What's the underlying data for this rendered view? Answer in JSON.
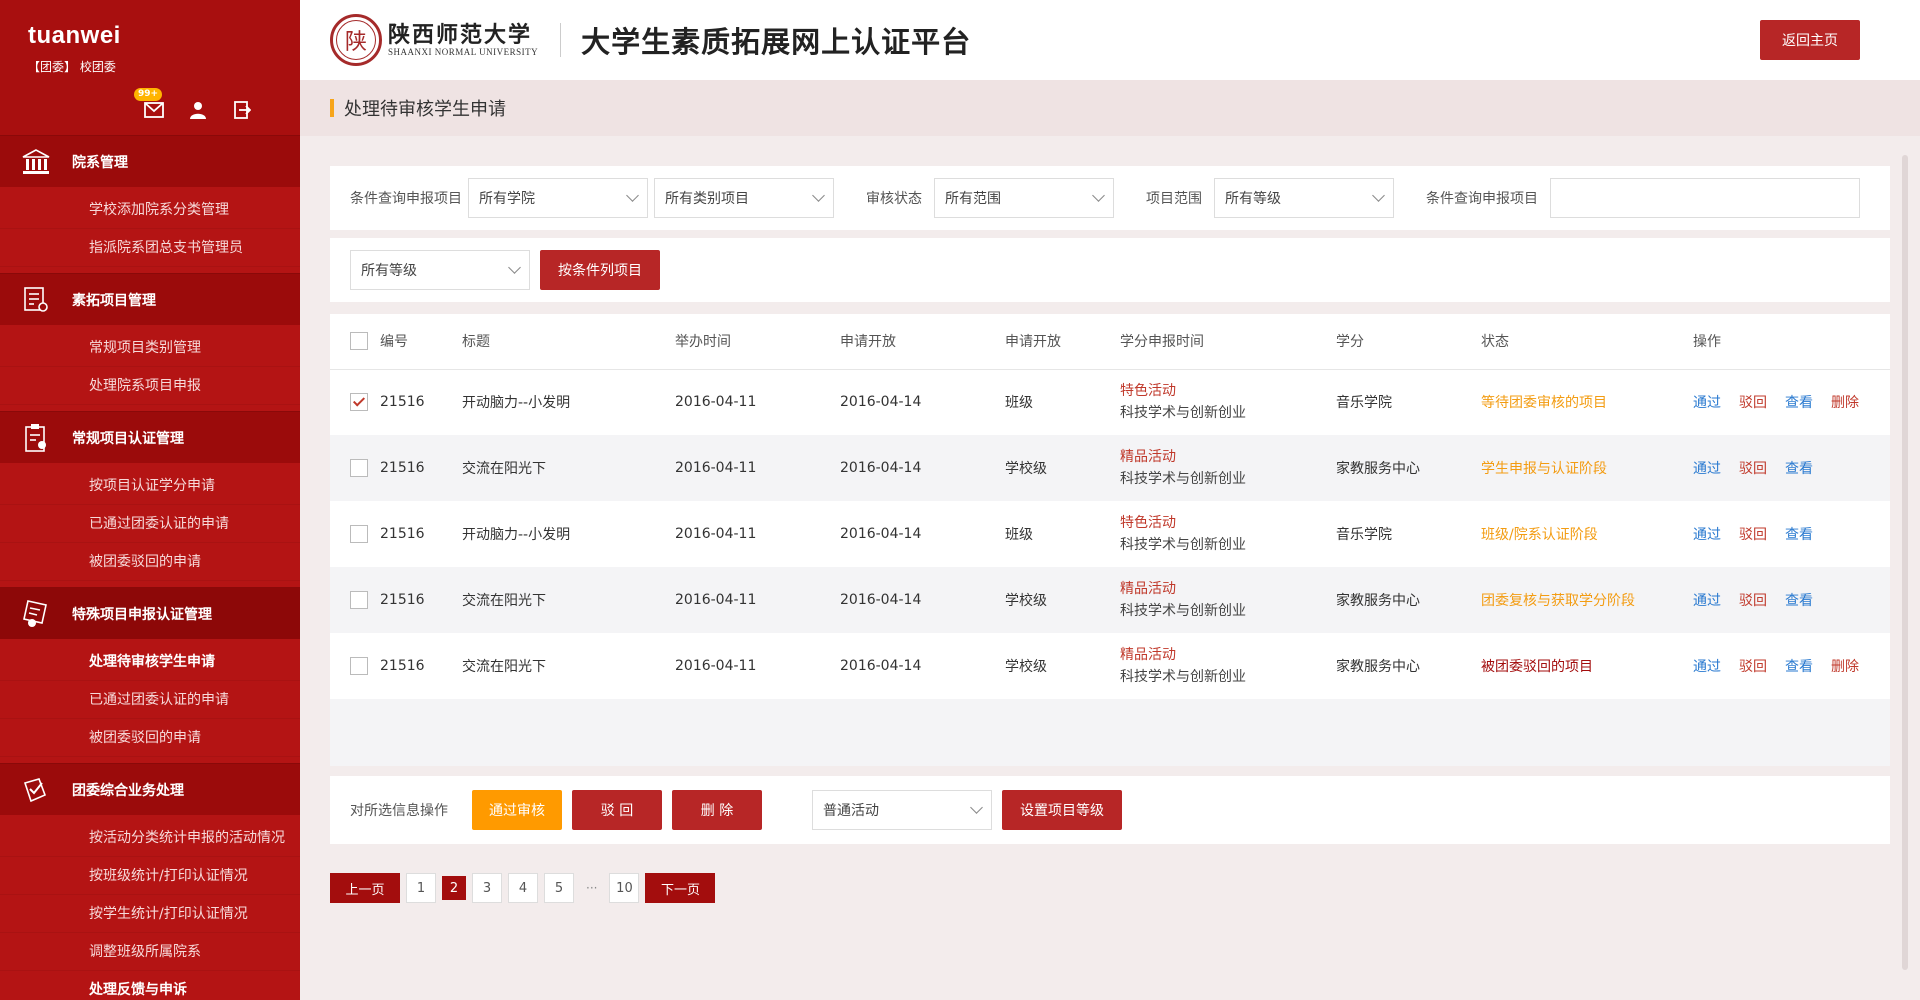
{
  "sidebar": {
    "user": "tuanwei",
    "role": "【团委】 校团委",
    "badge": "99+",
    "groups": [
      {
        "title": "院系管理",
        "icon": "building-icon",
        "items": [
          "学校添加院系分类管理",
          "指派院系团总支书管理员"
        ]
      },
      {
        "title": "素拓项目管理",
        "icon": "list-settings-icon",
        "items": [
          "常规项目类别管理",
          "处理院系项目申报"
        ]
      },
      {
        "title": "常规项目认证管理",
        "icon": "clipboard-user-icon",
        "items": [
          "按项目认证学分申请",
          "已通过团委认证的申请",
          "被团委驳回的申请"
        ]
      },
      {
        "title": "特殊项目申报认证管理",
        "icon": "certificate-icon",
        "items": [
          "处理待审核学生申请",
          "已通过团委认证的申请",
          "被团委驳回的申请"
        ]
      },
      {
        "title": "团委综合业务处理",
        "icon": "check-doc-icon",
        "items": [
          "按活动分类统计申报的活动情况",
          "按班级统计/打印认证情况",
          "按学生统计/打印认证情况",
          "调整班级所属院系",
          "处理反馈与申诉"
        ]
      }
    ]
  },
  "header": {
    "logo_seal": "陕",
    "logo_cn": "陕西师范大学",
    "logo_en": "SHAANXI NORMAL UNIVERSITY",
    "site_title": "大学生素质拓展网上认证平台",
    "home_button": "返回主页"
  },
  "page": {
    "title": "处理待审核学生申请"
  },
  "filters": {
    "label_query": "条件查询申报项目",
    "college": "所有学院",
    "category": "所有类别项目",
    "label_status": "审核状态",
    "scope": "所有范围",
    "label_range": "项目范围",
    "level": "所有等级",
    "label_query2": "条件查询申报项目",
    "level2": "所有等级",
    "list_button": "按条件列项目"
  },
  "table": {
    "headers": [
      "编号",
      "标题",
      "举办时间",
      "申请开放",
      "申请开放",
      "学分申报时间",
      "学分",
      "状态",
      "操作"
    ],
    "rows": [
      {
        "id": "21516",
        "title": "开动脑力--小发明",
        "date": "2016-04-11",
        "open": "2016-04-14",
        "level": "班级",
        "cat1": "特色活动",
        "cat2": "科技学术与创新创业",
        "college": "音乐学院",
        "status": "等待团委审核的项目",
        "ops": [
          "通过",
          "驳回",
          "查看",
          "删除"
        ]
      },
      {
        "id": "21516",
        "title": "交流在阳光下",
        "date": "2016-04-11",
        "open": "2016-04-14",
        "level": "学校级",
        "cat1": "精品活动",
        "cat2": "科技学术与创新创业",
        "college": "家教服务中心",
        "status": "学生申报与认证阶段",
        "ops": [
          "通过",
          "驳回",
          "查看"
        ]
      },
      {
        "id": "21516",
        "title": "开动脑力--小发明",
        "date": "2016-04-11",
        "open": "2016-04-14",
        "level": "班级",
        "cat1": "特色活动",
        "cat2": "科技学术与创新创业",
        "college": "音乐学院",
        "status": "班级/院系认证阶段",
        "ops": [
          "通过",
          "驳回",
          "查看"
        ]
      },
      {
        "id": "21516",
        "title": "交流在阳光下",
        "date": "2016-04-11",
        "open": "2016-04-14",
        "level": "学校级",
        "cat1": "精品活动",
        "cat2": "科技学术与创新创业",
        "college": "家教服务中心",
        "status": "团委复核与获取学分阶段",
        "ops": [
          "通过",
          "驳回",
          "查看"
        ]
      },
      {
        "id": "21516",
        "title": "交流在阳光下",
        "date": "2016-04-11",
        "open": "2016-04-14",
        "level": "学校级",
        "cat1": "精品活动",
        "cat2": "科技学术与创新创业",
        "college": "家教服务中心",
        "status": "被团委驳回的项目",
        "ops": [
          "通过",
          "驳回",
          "查看",
          "删除"
        ]
      }
    ]
  },
  "bulk": {
    "label": "对所选信息操作",
    "approve": "通过审核",
    "reject": "驳 回",
    "delete": "删 除",
    "activity_type": "普通活动",
    "set_level": "设置项目等级"
  },
  "pagination": {
    "prev": "上一页",
    "pages": [
      "1",
      "2",
      "3",
      "4",
      "5"
    ],
    "ellipsis": "···",
    "last": "10",
    "next": "下一页"
  },
  "colors": {
    "sidebar": "#b41414",
    "accent": "#b72626",
    "orange": "#ff9a00",
    "status_orange": "#f39c12",
    "status_red": "#a30d0d",
    "link_blue": "#2a7ad0"
  }
}
